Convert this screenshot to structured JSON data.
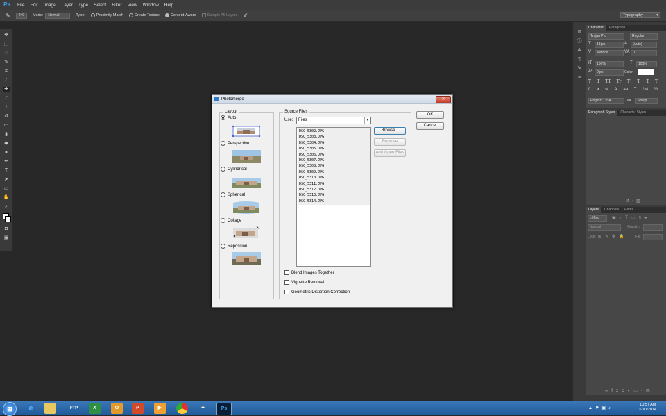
{
  "menubar": {
    "logo": "Ps",
    "items": [
      "File",
      "Edit",
      "Image",
      "Layer",
      "Type",
      "Select",
      "Filter",
      "View",
      "Window",
      "Help"
    ]
  },
  "options": {
    "brush_size": "249",
    "mode_label": "Mode:",
    "mode_value": "Normal",
    "type_label": "Type:",
    "type_options": [
      "Proximity Match",
      "Create Texture",
      "Content-Aware"
    ],
    "selected_type": "Content-Aware",
    "sample_label": "Sample All Layers",
    "workspace": "Typography"
  },
  "right_panel": {
    "tabs": [
      "Character",
      "Paragraph"
    ],
    "font": "Trajan Pro",
    "style": "Regular",
    "size": "18 px",
    "leading": "(Auto)",
    "kerning": "Metrics",
    "tracking": "0",
    "vscale": "100%",
    "hscale": "100%",
    "baseline": "0 px",
    "color_label": "Color:",
    "type_buttons": [
      "T",
      "T",
      "TT",
      "Tr",
      "T¹",
      "T,",
      "T",
      "Ŧ"
    ],
    "language": "English: USA",
    "aa": "Sharp",
    "aa_prefix": "aa",
    "style_tabs": [
      "Paragraph Styles",
      "Character Styles"
    ],
    "layer_tabs": [
      "Layers",
      "Channels",
      "Paths"
    ],
    "kind_label": "Kind",
    "blend": "Normal",
    "opacity_label": "Opacity:",
    "lock_label": "Lock:",
    "fill_label": "Fill:"
  },
  "dialog": {
    "title": "Photomerge",
    "close": "✕",
    "layout_label": "Layout",
    "layout_options": [
      "Auto",
      "Perspective",
      "Cylindrical",
      "Spherical",
      "Collage",
      "Reposition"
    ],
    "selected_layout": "Auto",
    "source_label": "Source Files",
    "use_label": "Use:",
    "use_value": "Files",
    "files": [
      "DSC_5302.JPG",
      "DSC_5303.JPG",
      "DSC_5304.JPG",
      "DSC_5305.JPG",
      "DSC_5306.JPG",
      "DSC_5307.JPG",
      "DSC_5308.JPG",
      "DSC_5309.JPG",
      "DSC_5310.JPG",
      "DSC_5311.JPG",
      "DSC_5312.JPG",
      "DSC_5313.JPG",
      "DSC_5314.JPG"
    ],
    "buttons": {
      "browse": "Browse...",
      "remove": "Remove",
      "add_open": "Add Open Files",
      "ok": "OK",
      "cancel": "Cancel"
    },
    "checkboxes": [
      "Blend Images Together",
      "Vignette Removal",
      "Geometric Distortion Correction"
    ]
  },
  "taskbar": {
    "time": "10:57 AM",
    "date": "6/10/2014"
  },
  "colors": {
    "dialog_bg": "#f0f0f0",
    "app_bg": "#282828",
    "taskbar": "#2a67a8",
    "ps_blue": "#3fa0e8"
  }
}
